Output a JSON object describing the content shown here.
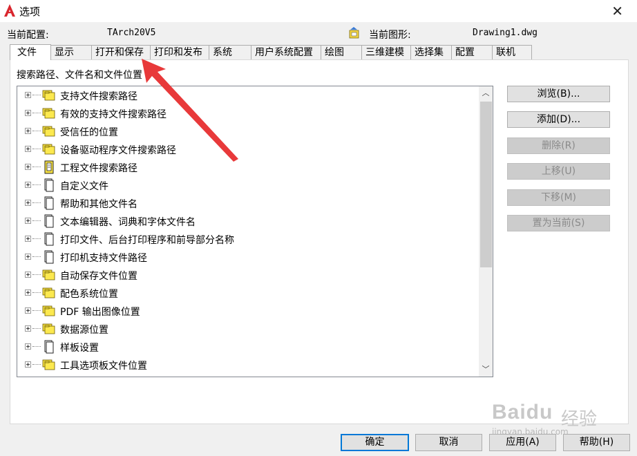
{
  "window": {
    "title": "选项",
    "close_glyph": "✕",
    "brand_color": "#d9262e"
  },
  "profile": {
    "label": "当前配置:",
    "value": "TArch20V5",
    "drawing_label": "当前图形:",
    "drawing_value": "Drawing1.dwg",
    "drawing_icon": "drawing-file-icon"
  },
  "tabs": [
    {
      "label": "文件",
      "active": true
    },
    {
      "label": "显示"
    },
    {
      "label": "打开和保存"
    },
    {
      "label": "打印和发布"
    },
    {
      "label": "系统"
    },
    {
      "label": "用户系统配置"
    },
    {
      "label": "绘图"
    },
    {
      "label": "三维建模"
    },
    {
      "label": "选择集"
    },
    {
      "label": "配置"
    },
    {
      "label": "联机"
    }
  ],
  "section_label": "搜索路径、文件名和文件位置",
  "tree": {
    "items": [
      {
        "label": "支持文件搜索路径",
        "icon": "folder-stack-icon"
      },
      {
        "label": "有效的支持文件搜索路径",
        "icon": "folder-stack-icon"
      },
      {
        "label": "受信任的位置",
        "icon": "folder-stack-icon"
      },
      {
        "label": "设备驱动程序文件搜索路径",
        "icon": "folder-stack-icon"
      },
      {
        "label": "工程文件搜索路径",
        "icon": "project-file-icon"
      },
      {
        "label": "自定义文件",
        "icon": "document-icon"
      },
      {
        "label": "帮助和其他文件名",
        "icon": "document-icon"
      },
      {
        "label": "文本编辑器、词典和字体文件名",
        "icon": "document-icon"
      },
      {
        "label": "打印文件、后台打印程序和前导部分名称",
        "icon": "document-icon"
      },
      {
        "label": "打印机支持文件路径",
        "icon": "document-icon"
      },
      {
        "label": "自动保存文件位置",
        "icon": "folder-stack-icon"
      },
      {
        "label": "配色系统位置",
        "icon": "folder-stack-icon"
      },
      {
        "label": "PDF 输出图像位置",
        "icon": "folder-stack-icon"
      },
      {
        "label": "数据源位置",
        "icon": "folder-stack-icon"
      },
      {
        "label": "样板设置",
        "icon": "document-icon"
      },
      {
        "label": "工具选项板文件位置",
        "icon": "folder-stack-icon"
      }
    ],
    "scroll_up_glyph": "︿",
    "scroll_down_glyph": "﹀"
  },
  "side_buttons": [
    {
      "label": "浏览(B)...",
      "enabled": true
    },
    {
      "label": "添加(D)...",
      "enabled": true
    },
    {
      "label": "删除(R)",
      "enabled": false
    },
    {
      "label": "上移(U)",
      "enabled": false
    },
    {
      "label": "下移(M)",
      "enabled": false
    },
    {
      "label": "置为当前(S)",
      "enabled": false
    }
  ],
  "bottom_buttons": [
    {
      "label": "确定",
      "default": true
    },
    {
      "label": "取消"
    },
    {
      "label": "应用(A)"
    },
    {
      "label": "帮助(H)"
    }
  ],
  "annotation": {
    "color": "#e8393a"
  },
  "watermark": {
    "brand": "Baidu",
    "brand_cn": "经验",
    "url": "jingyan.baidu.com"
  }
}
